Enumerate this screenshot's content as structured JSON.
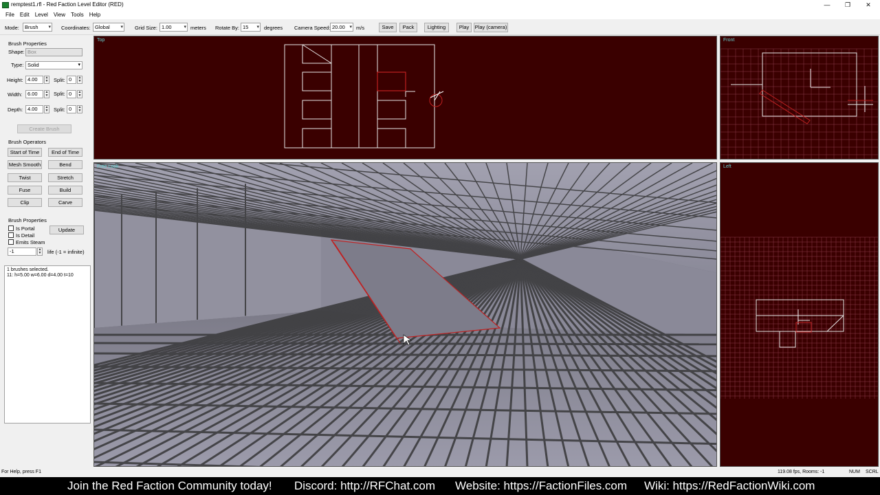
{
  "window": {
    "title": "remptest1.rfl - Red Faction Level Editor (RED)",
    "controls": [
      "—",
      "❐",
      "✕"
    ]
  },
  "menu": [
    "File",
    "Edit",
    "Level",
    "View",
    "Tools",
    "Help"
  ],
  "toolbar": {
    "mode_label": "Mode:",
    "mode_value": "Brush",
    "coords_label": "Coordinates:",
    "coords_value": "Global",
    "grid_label": "Grid Size:",
    "grid_value": "1.00",
    "grid_unit": "meters",
    "rotate_label": "Rotate By:",
    "rotate_value": "15",
    "rotate_unit": "degrees",
    "camspeed_label": "Camera Speed:",
    "camspeed_value": "20.00",
    "camspeed_unit": "m/s",
    "buttons": [
      "Save",
      "Pack",
      "Lighting",
      "Play",
      "Play (camera)"
    ]
  },
  "left_panel": {
    "brush_properties_title": "Brush Properties",
    "shape_label": "Shape:",
    "shape_value": "Box",
    "type_label": "Type:",
    "type_value": "Solid",
    "height_label": "Height:",
    "height_value": "4.00",
    "width_label": "Width:",
    "width_value": "6.00",
    "depth_label": "Depth:",
    "depth_value": "4.00",
    "split_label": "Split:",
    "split_values": [
      "0",
      "0",
      "0"
    ],
    "create_brush": "Create Brush",
    "operators_title": "Brush Operators",
    "operators": [
      "Start of Time",
      "End of Time",
      "Mesh Smooth",
      "Bend",
      "Twist",
      "Stretch",
      "Fuse",
      "Build",
      "Clip",
      "Carve"
    ],
    "brush_props_title": "Brush Properties",
    "is_portal": "Is Portal",
    "is_detail": "Is Detail",
    "emits_steam": "Emits Steam",
    "update": "Update",
    "life_value": "-1",
    "life_label": "life (-1 = infinite)",
    "info_lines": [
      "1 brushes selected.",
      "11: h=5.00 w=6.00 d=4.00 t=10"
    ]
  },
  "viewports": {
    "top": "Top",
    "front": "Front",
    "left": "Left",
    "free": "Free Look"
  },
  "status": {
    "help": "For Help, press F1",
    "fps": "119.08 fps, Rooms: -1",
    "num": "NUM",
    "scrl": "SCRL"
  },
  "banner": {
    "join": "Join the Red Faction Community today!",
    "discord": "Discord: http://RFChat.com",
    "website": "Website: https://FactionFiles.com",
    "wiki": "Wiki: https://RedFactionWiki.com"
  },
  "colors": {
    "viewport_bg": "#3a0000",
    "floor": "#8d8c99",
    "grid_line": "#3c3c3e",
    "selection": "#c02020"
  }
}
